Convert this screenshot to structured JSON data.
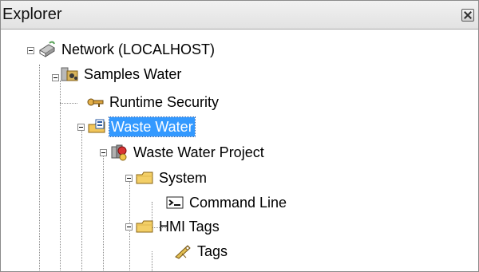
{
  "panel": {
    "title": "Explorer",
    "close_icon": "close-icon"
  },
  "tree": [
    {
      "id": "network",
      "label": "Network (LOCALHOST)",
      "icon": "network-icon"
    },
    {
      "id": "samples",
      "label": "Samples Water",
      "icon": "application-folder-icon"
    },
    {
      "id": "runtime",
      "label": "Runtime Security",
      "icon": "key-icon"
    },
    {
      "id": "waste",
      "label": "Waste Water",
      "icon": "open-folder-blue-icon",
      "selected": true
    },
    {
      "id": "project",
      "label": "Waste Water Project",
      "icon": "project-icon"
    },
    {
      "id": "system",
      "label": "System",
      "icon": "folder-icon"
    },
    {
      "id": "command",
      "label": "Command Line",
      "icon": "command-line-icon"
    },
    {
      "id": "hmi",
      "label": "HMI Tags",
      "icon": "folder-icon"
    },
    {
      "id": "tags",
      "label": "Tags",
      "icon": "tags-icon"
    }
  ]
}
